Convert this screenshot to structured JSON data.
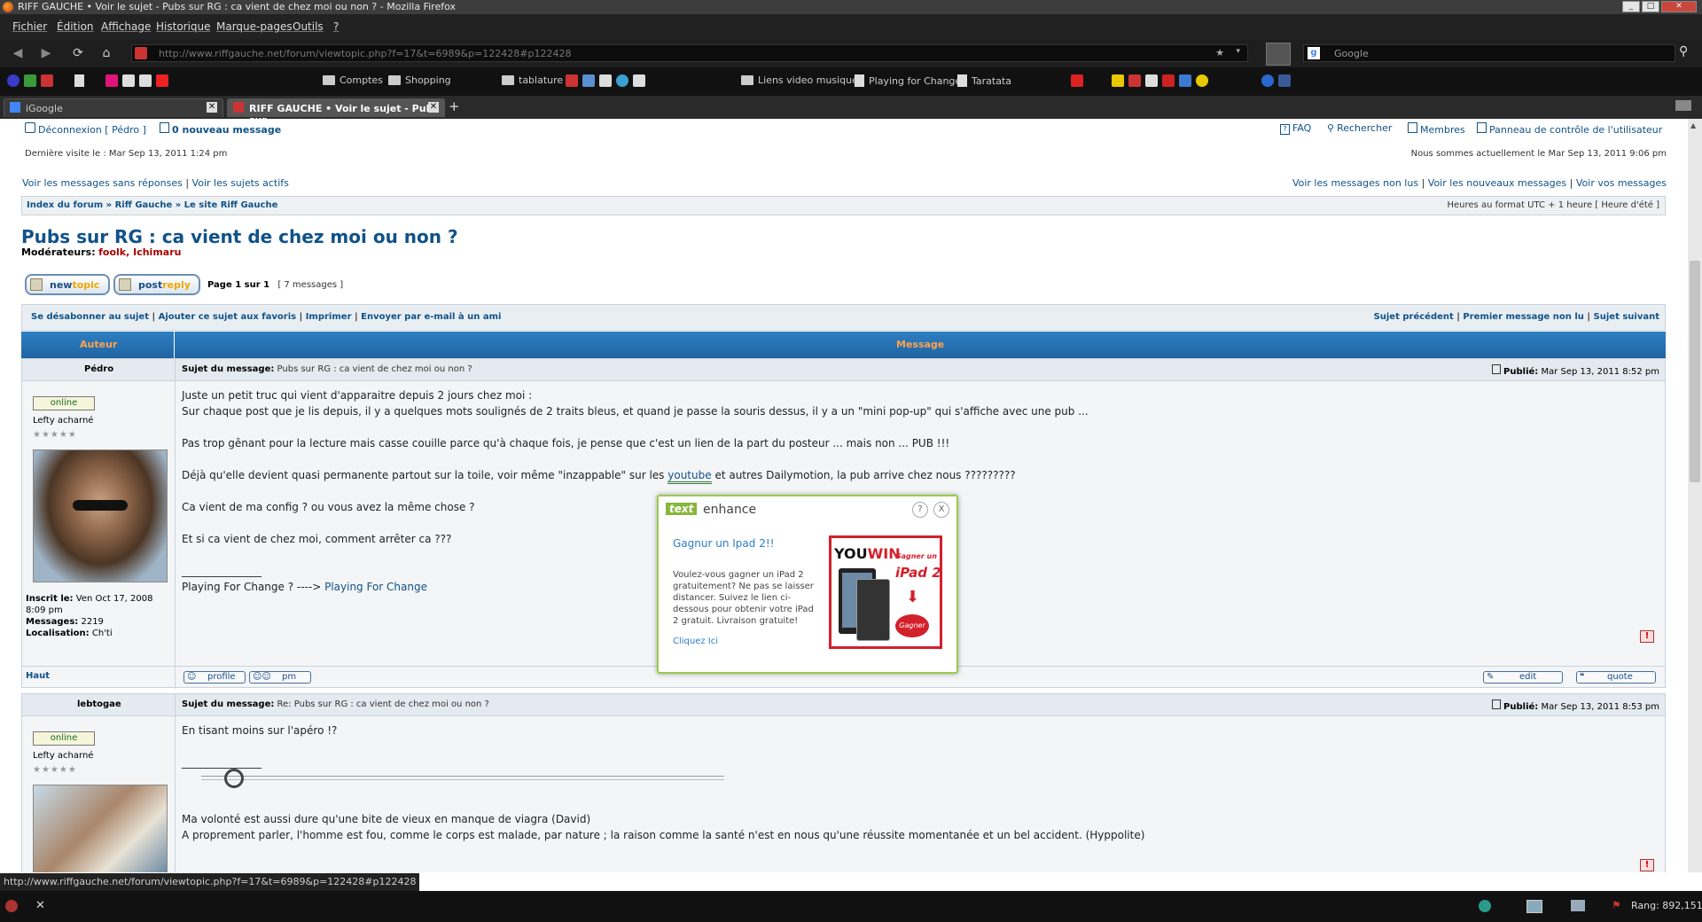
{
  "window": {
    "title": "RIFF GAUCHE • Voir le sujet - Pubs sur RG : ca vient de chez moi ou non ? - Mozilla Firefox",
    "controls": [
      "_",
      "□",
      "✕"
    ]
  },
  "menu": {
    "items": [
      "Fichier",
      "Édition",
      "Affichage",
      "Historique",
      "Marque-pages",
      "Outils",
      "?"
    ]
  },
  "nav": {
    "url": "http://www.riffgauche.net/forum/viewtopic.php?f=17&t=6989&p=122428#p122428",
    "search_placeholder": "Google"
  },
  "bookmarks": {
    "folders": [
      "Comptes",
      "Shopping",
      "tablature",
      "Liens video musique",
      "Playing for Change",
      "Taratata"
    ]
  },
  "tabs": [
    {
      "label": "iGoogle"
    },
    {
      "label": "RIFF GAUCHE • Voir le sujet - Pubs sur..."
    }
  ],
  "forum": {
    "top_links": {
      "logout": "Déconnexion [ Pédro ]",
      "new_message": "0 nouveau message",
      "faq": "FAQ",
      "search": "Rechercher",
      "members": "Membres",
      "control_panel": "Panneau de contrôle de l'utilisateur"
    },
    "last_visit": "Dernière visite le : Mar Sep 13, 2011 1:24 pm",
    "current_time": "Nous sommes actuellement le Mar Sep 13, 2011 9:06 pm",
    "left_links": {
      "unanswered": "Voir les messages sans réponses",
      "active": "Voir les sujets actifs"
    },
    "right_links": {
      "unread": "Voir les messages non lus",
      "new": "Voir les nouveaux messages",
      "yours": "Voir vos messages"
    },
    "breadcrumb": {
      "index": "Index du forum",
      "cat": "Riff Gauche",
      "sub": "Le site Riff Gauche"
    },
    "timezone": "Heures au format UTC + 1 heure [ Heure d'été ]",
    "topic_title": "Pubs sur RG : ca vient de chez moi ou non ?",
    "moderators_label": "Modérateurs:",
    "moderators": "foolk, Ichimaru",
    "buttons": {
      "newtopic_a": "new",
      "newtopic_b": "topic",
      "postreply_a": "post",
      "postreply_b": "reply"
    },
    "pagination": "Page 1 sur 1",
    "count": "[ 7 messages ]",
    "actions": {
      "unsubscribe": "Se désabonner au sujet",
      "bookmark": "Ajouter ce sujet aux favoris",
      "print": "Imprimer",
      "email": "Envoyer par e-mail à un ami",
      "prev": "Sujet précédent",
      "first_unread": "Premier message non lu",
      "next": "Sujet suivant"
    },
    "table_headers": {
      "author": "Auteur",
      "message": "Message"
    },
    "posts": [
      {
        "author": "Pédro",
        "status": "online",
        "rank": "Lefty acharné",
        "stars": "★★★★★",
        "subject_label": "Sujet du message:",
        "subject": "Pubs sur RG : ca vient de chez moi ou non ?",
        "posted_label": "Publié:",
        "posted": "Mar Sep 13, 2011 8:52 pm",
        "lines": [
          "Juste un petit truc qui vient d'apparaitre depuis 2 jours chez moi :",
          "Sur chaque post que je lis depuis, il y a quelques mots soulignés de 2 traits bleus, et quand je passe la souris dessus, il y a un \"mini pop-up\" qui s'affiche avec une pub ...",
          "Pas trop gênant pour la lecture mais casse couille parce qu'à chaque fois, je pense que c'est un lien de la part du posteur ... mais non ... PUB !!!",
          "Déjà qu'elle devient quasi permanente partout sur la toile, voir même \"inzappable\" sur les",
          "youtube",
          "et autres Dailymotion, la pub arrive chez nous ?????????",
          "Ca vient de ma config ? ou vous avez la même chose ?",
          "Et si ca vient de chez moi, comment arrêter ca ???",
          "_______________",
          "Playing For Change ? ----> ",
          "Playing For Change"
        ],
        "joined_label": "Inscrit le:",
        "joined": "Ven Oct 17, 2008 8:09 pm",
        "messages_label": "Messages:",
        "messages": "2219",
        "location_label": "Localisation:",
        "location": "Ch'ti",
        "top_link": "Haut",
        "btn_profile": "profile",
        "btn_pm": "pm",
        "btn_edit": "edit",
        "btn_quote": "quote"
      },
      {
        "author": "lebtogae",
        "status": "online",
        "rank": "Lefty acharné",
        "stars": "★★★★★",
        "subject_label": "Sujet du message:",
        "subject": "Re: Pubs sur RG : ca vient de chez moi ou non ?",
        "posted_label": "Publié:",
        "posted": "Mar Sep 13, 2011 8:53 pm",
        "lines": [
          "En tisant moins sur l'apéro !?",
          "_______________",
          "Ma volonté est aussi dure qu'une bite de vieux en manque de viagra (David)",
          "A proprement parler, l'homme est fou, comme le corps est malade, par nature ; la raison comme la santé n'est en nous qu'une réussite momentanée et un bel accident. (Hyppolite)"
        ]
      }
    ]
  },
  "popup": {
    "brand_a": "text",
    "brand_b": "enhance",
    "help": "?",
    "close": "X",
    "headline": "Gagnur un Ipad 2!!",
    "body": "Voulez-vous gagner un iPad 2 gratuitement? Ne pas se laisser distancer. Suivez le lien ci-dessous pour obtenir votre iPad 2 gratuit. Livraison gratuite!",
    "cta": "Cliquez Ici",
    "ad_you": "YOU",
    "ad_win": "WIN",
    "ad_gagner": "Gagner un",
    "ad_ipad": "iPad 2",
    "ad_btn": "Gagner"
  },
  "status": {
    "url": "http://www.riffgauche.net/forum/viewtopic.php?f=17&t=6989&p=122428#p122428",
    "rank": "Rang: 892,151"
  }
}
